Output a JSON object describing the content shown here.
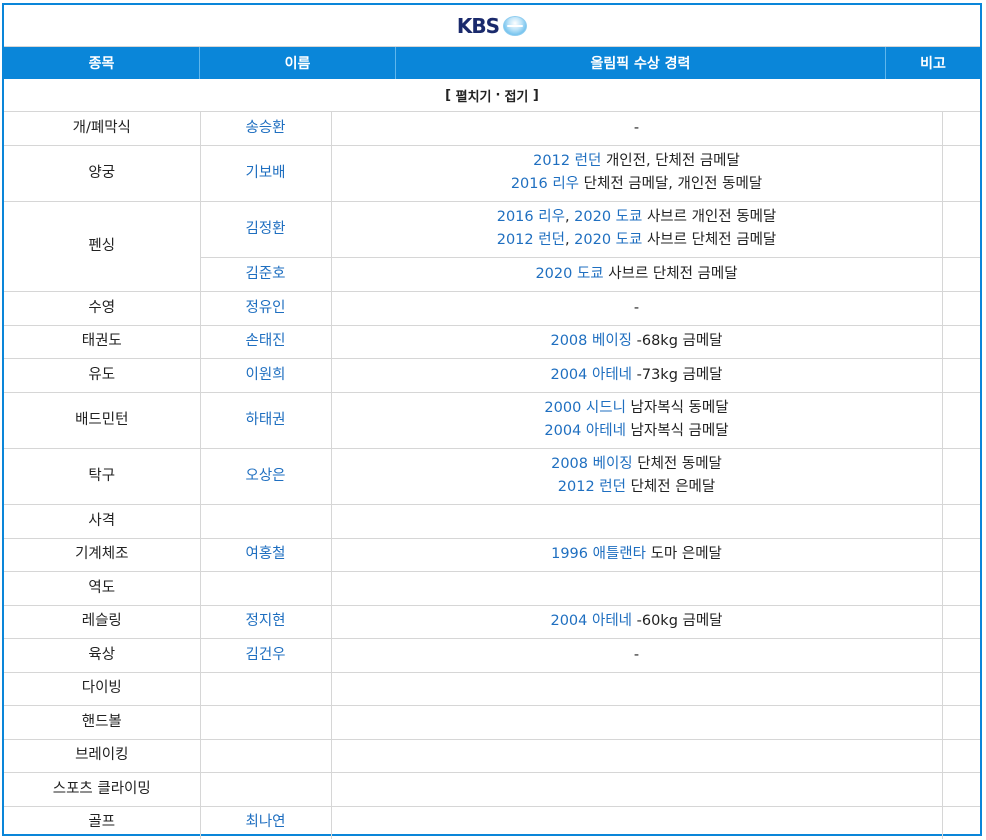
{
  "brand": {
    "logo_text": "KBS"
  },
  "header": {
    "col_sport": "종목",
    "col_name": "이름",
    "col_record": "올림픽 수상 경력",
    "col_note": "비고"
  },
  "toggle": {
    "open_bracket": "[",
    "expand": "펼치기",
    "dot": "·",
    "collapse": "접기",
    "close_bracket": "]"
  },
  "colors": {
    "accent": "#0a86d9",
    "link": "#1f6fc0"
  },
  "rows": [
    {
      "sport": "개/폐막식",
      "name": "송승환",
      "record": [
        [
          {
            "t": "-",
            "link": false
          }
        ]
      ]
    },
    {
      "sport": "양궁",
      "name": "기보배",
      "record": [
        [
          {
            "t": "2012 런던",
            "link": true
          },
          {
            "t": " 개인전, 단체전 금메달",
            "link": false
          }
        ],
        [
          {
            "t": "2016 리우",
            "link": true
          },
          {
            "t": " 단체전 금메달, 개인전 동메달",
            "link": false
          }
        ]
      ]
    },
    {
      "sport": "펜싱",
      "name": "김정환",
      "record": [
        [
          {
            "t": "2016 리우",
            "link": true
          },
          {
            "t": ", ",
            "link": false
          },
          {
            "t": "2020 도쿄",
            "link": true
          },
          {
            "t": " 사브르 개인전 동메달",
            "link": false
          }
        ],
        [
          {
            "t": "2012 런던",
            "link": true
          },
          {
            "t": ", ",
            "link": false
          },
          {
            "t": "2020 도쿄",
            "link": true
          },
          {
            "t": " 사브르 단체전 금메달",
            "link": false
          }
        ]
      ]
    },
    {
      "sport": "",
      "name": "김준호",
      "record": [
        [
          {
            "t": "2020 도쿄",
            "link": true
          },
          {
            "t": " 사브르 단체전 금메달",
            "link": false
          }
        ]
      ]
    },
    {
      "sport": "수영",
      "name": "정유인",
      "record": [
        [
          {
            "t": "-",
            "link": false
          }
        ]
      ]
    },
    {
      "sport": "태권도",
      "name": "손태진",
      "record": [
        [
          {
            "t": "2008 베이징",
            "link": true
          },
          {
            "t": " -68kg 금메달",
            "link": false
          }
        ]
      ]
    },
    {
      "sport": "유도",
      "name": "이원희",
      "record": [
        [
          {
            "t": "2004 아테네",
            "link": true
          },
          {
            "t": " -73kg 금메달",
            "link": false
          }
        ]
      ]
    },
    {
      "sport": "배드민턴",
      "name": "하태권",
      "record": [
        [
          {
            "t": "2000 시드니",
            "link": true
          },
          {
            "t": " 남자복식 동메달",
            "link": false
          }
        ],
        [
          {
            "t": "2004 아테네",
            "link": true
          },
          {
            "t": " 남자복식 금메달",
            "link": false
          }
        ]
      ]
    },
    {
      "sport": "탁구",
      "name": "오상은",
      "record": [
        [
          {
            "t": "2008 베이징",
            "link": true
          },
          {
            "t": " 단체전 동메달",
            "link": false
          }
        ],
        [
          {
            "t": "2012 런던",
            "link": true
          },
          {
            "t": " 단체전 은메달",
            "link": false
          }
        ]
      ]
    },
    {
      "sport": "사격",
      "name": "",
      "record": []
    },
    {
      "sport": "기계체조",
      "name": "여홍철",
      "record": [
        [
          {
            "t": "1996 애틀랜타",
            "link": true
          },
          {
            "t": " 도마 은메달",
            "link": false
          }
        ]
      ]
    },
    {
      "sport": "역도",
      "name": "",
      "record": []
    },
    {
      "sport": "레슬링",
      "name": "정지현",
      "record": [
        [
          {
            "t": "2004 아테네",
            "link": true
          },
          {
            "t": " -60kg 금메달",
            "link": false
          }
        ]
      ]
    },
    {
      "sport": "육상",
      "name": "김건우",
      "record": [
        [
          {
            "t": "-",
            "link": false
          }
        ]
      ]
    },
    {
      "sport": "다이빙",
      "name": "",
      "record": []
    },
    {
      "sport": "핸드볼",
      "name": "",
      "record": []
    },
    {
      "sport": "브레이킹",
      "name": "",
      "record": []
    },
    {
      "sport": "스포츠 클라이밍",
      "name": "",
      "record": []
    },
    {
      "sport": "골프",
      "name": "최나연",
      "record": []
    }
  ]
}
